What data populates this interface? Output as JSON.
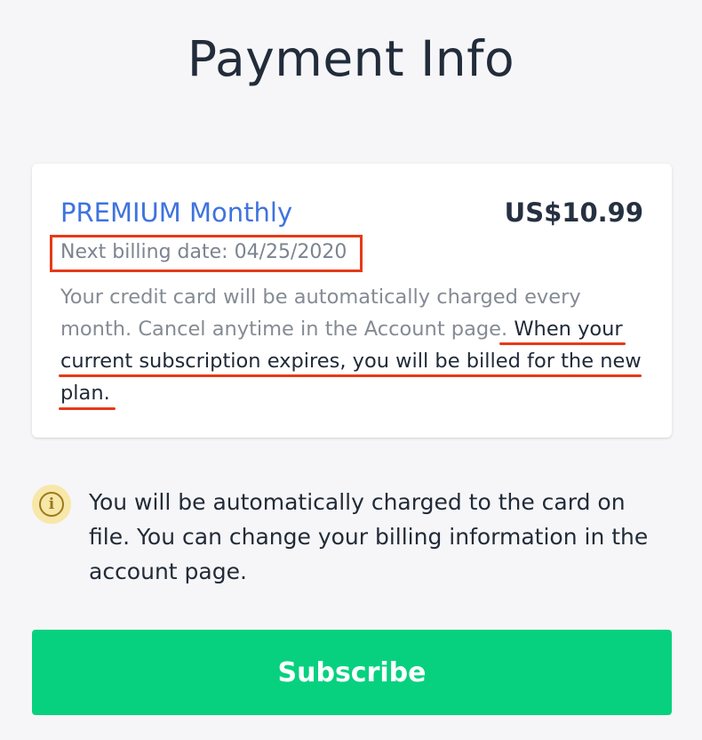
{
  "page": {
    "title": "Payment Info"
  },
  "plan_card": {
    "plan_name": "PREMIUM Monthly",
    "price": "US$10.99",
    "billing_date": "Next billing date: 04/25/2020",
    "description_intro": "Your credit card will be automatically charged every month. Cancel anytime in the Account page.",
    "description_highlight": "When your current subscription expires, you will be billed for the new plan."
  },
  "info": {
    "icon": "info-icon",
    "text": "You will be automatically charged to the card on file. You can change your billing information in the account page."
  },
  "actions": {
    "subscribe_label": "Subscribe"
  },
  "colors": {
    "accent_blue": "#3f73df",
    "subscribe_green": "#07d17f",
    "annotation_red": "#e63a18",
    "info_yellow": "#f7e7a8"
  }
}
